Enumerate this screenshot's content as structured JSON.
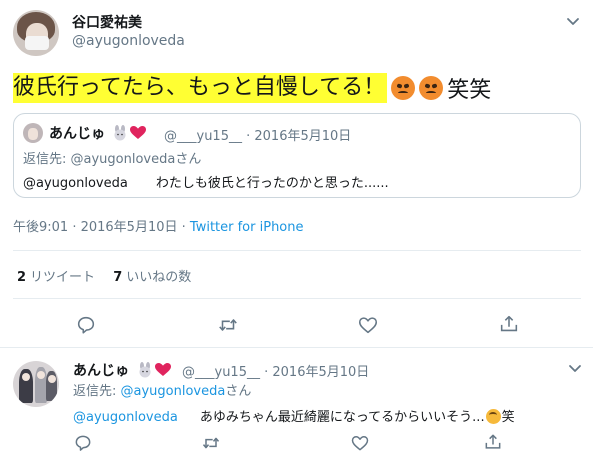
{
  "main_tweet": {
    "author_name": "谷口愛祐美",
    "author_handle": "@ayugonloveda",
    "text_highlighted": "彼氏行ってたら、もっと自慢してる！",
    "text_tail": "笑笑",
    "emojis": [
      "angry-face-icon",
      "angry-face-icon"
    ],
    "timestamp": "午後9:01 · 2016年5月10日",
    "source": "Twitter for iPhone",
    "highlight_color": "#ffff33",
    "stats": {
      "retweets_count": "2",
      "retweets_label": "リツイート",
      "likes_count": "7",
      "likes_label": "いいねの数"
    }
  },
  "quoted_tweet": {
    "author_name": "あんじゅ",
    "author_handle": "@___yu15__",
    "date": "· 2016年5月10日",
    "reply_prefix": "返信先: ",
    "reply_to": "@ayugonloveda",
    "reply_suffix": "さん",
    "body_mention": "@ayugonloveda",
    "body_text": "わたしも彼氏と行ったのかと思った......"
  },
  "reply_tweet": {
    "author_name": "あんじゅ",
    "author_handle": "@___yu15__",
    "date": "· 2016年5月10日",
    "reply_prefix": "返信先: ",
    "reply_to": "@ayugonloveda",
    "reply_suffix": "さん",
    "body_mention": "@ayugonloveda",
    "body_text": "あゆみちゃん最近綺麗になってるからいいそう...",
    "body_tail": "笑"
  },
  "colors": {
    "link": "#1b95e0",
    "secondary_text": "#657786",
    "border": "#e6ecf0"
  }
}
